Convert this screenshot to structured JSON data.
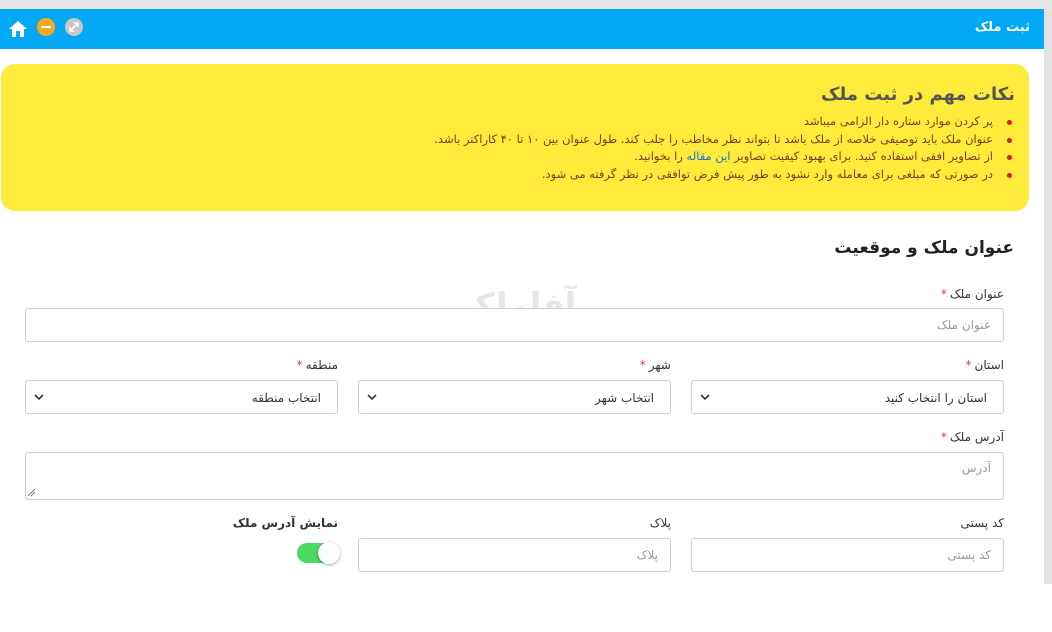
{
  "window": {
    "title": "ثبت ملک"
  },
  "notice": {
    "title": "نکات مهم در ثبت ملک",
    "items": [
      "پر کردن موارد ستاره دار الزامی میباشد",
      "عنوان ملک باید توصیفی خلاصه از ملک باشد تا بتواند نظر مخاطب را جلب کند. طول عنوان بین ۱۰ تا ۴۰ کاراکتر باشد.",
      "را بخوانید.",
      "در صورتی که مبلغی برای معامله وارد نشود به طور پیش فرض توافقی در نظر گرفته می شود."
    ],
    "item3_prefix": "از تصاویر افقی استفاده کنید. برای بهبود کیفیت تصاویر",
    "item3_link": "این مقاله"
  },
  "section": {
    "title": "عنوان ملک و موقعیت"
  },
  "watermark": "آفاملک",
  "form": {
    "required_mark": "*",
    "title_label": "عنوان ملک",
    "title_placeholder": "عنوان ملک",
    "province_label": "استان",
    "province_value": "استان را انتخاب کنید",
    "city_label": "شهر",
    "city_value": "انتخاب شهر",
    "region_label": "منطقه",
    "region_value": "انتخاب منطقه",
    "address_label": "آدرس ملک",
    "address_placeholder": "آدرس",
    "postal_label": "کد پستی",
    "postal_placeholder": "کد پستی",
    "plaque_label": "پلاک",
    "plaque_placeholder": "پلاک",
    "show_address_label": "نمایش آدرس ملک",
    "show_address_on": true
  },
  "colors": {
    "titlebar": "#03a9f4",
    "notice_bg": "#ffeb3b",
    "toggle_on": "#4cd964",
    "required": "#e53935"
  }
}
